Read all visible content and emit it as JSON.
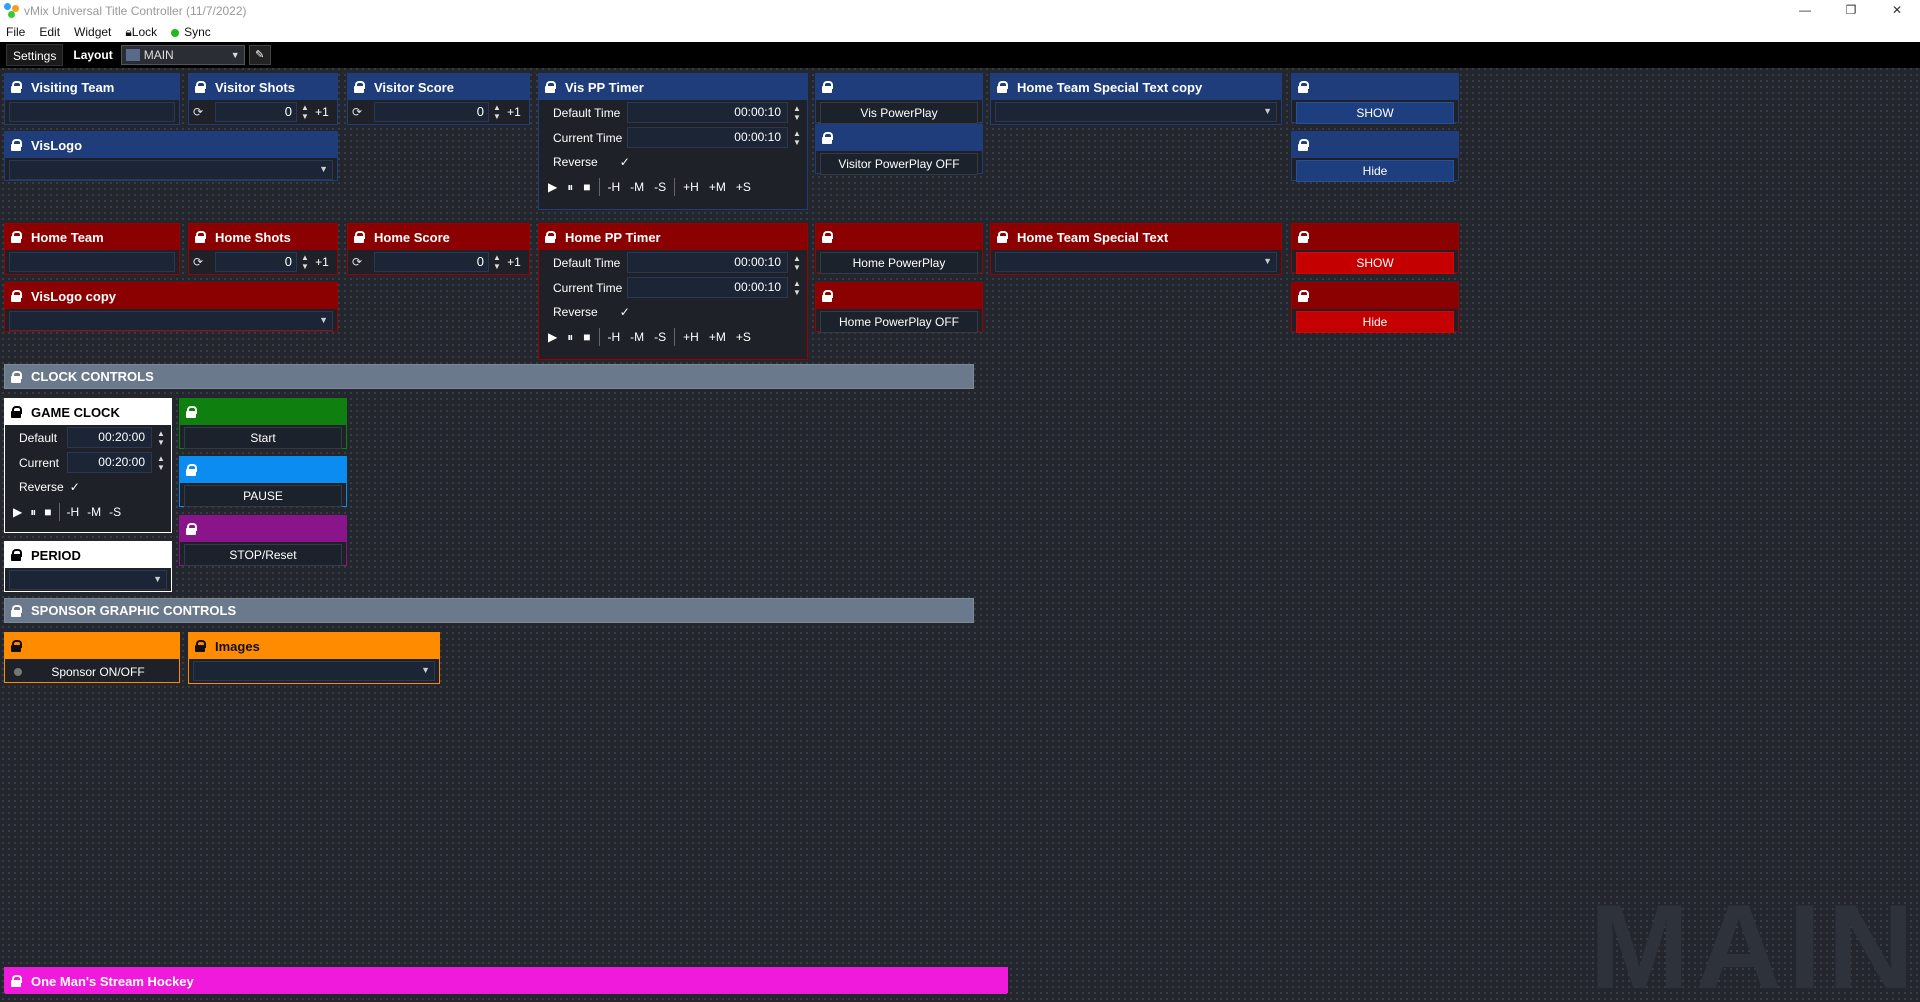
{
  "window": {
    "title": "vMix Universal Title Controller (11/7/2022)",
    "buttons": [
      "—",
      "❐",
      "✕"
    ]
  },
  "menu": {
    "file": "File",
    "edit": "Edit",
    "widget": "Widget",
    "lock": "🔒︎Lock",
    "sync": "Sync"
  },
  "toolbar": {
    "settings": "Settings",
    "layout": "Layout",
    "layout_value": "MAIN"
  },
  "widgets": {
    "visiting_team": {
      "title": "Visiting Team"
    },
    "visitor_shots": {
      "title": "Visitor Shots",
      "value": "0",
      "plus": "+1"
    },
    "visitor_score": {
      "title": "Visitor Score",
      "value": "0",
      "plus": "+1"
    },
    "vis_pp_timer": {
      "title": "Vis PP Timer",
      "default_label": "Default Time",
      "default_value": "00:00:10",
      "current_label": "Current Time",
      "current_value": "00:00:10",
      "reverse_label": "Reverse",
      "check": "✓"
    },
    "vis_powerplay": {
      "label": "Vis PowerPlay"
    },
    "visitor_powerplay_off": {
      "label": "Visitor PowerPlay OFF"
    },
    "home_special_copy": {
      "title": "Home Team Special Text copy"
    },
    "show_blue": {
      "label": "SHOW"
    },
    "hide_blue": {
      "label": "Hide"
    },
    "vislogo": {
      "title": "VisLogo"
    },
    "home_team": {
      "title": "Home Team"
    },
    "home_shots": {
      "title": "Home Shots",
      "value": "0",
      "plus": "+1"
    },
    "home_score": {
      "title": "Home Score",
      "value": "0",
      "plus": "+1"
    },
    "home_pp_timer": {
      "title": "Home PP Timer",
      "default_label": "Default Time",
      "default_value": "00:00:10",
      "current_label": "Current Time",
      "current_value": "00:00:10",
      "reverse_label": "Reverse",
      "check": "✓"
    },
    "home_powerplay": {
      "label": "Home PowerPlay"
    },
    "home_powerplay_off": {
      "label": "Home PowerPlay OFF"
    },
    "home_special": {
      "title": "Home Team Special Text"
    },
    "show_red": {
      "label": "SHOW"
    },
    "hide_red": {
      "label": "Hide"
    },
    "vislogo_copy": {
      "title": "VisLogo copy"
    },
    "clock_controls": {
      "title": "CLOCK CONTROLS"
    },
    "game_clock": {
      "title": "GAME CLOCK",
      "default_label": "Default",
      "default_value": "00:20:00",
      "current_label": "Current",
      "current_value": "00:20:00",
      "reverse_label": "Reverse",
      "check": "✓"
    },
    "start": {
      "label": "Start"
    },
    "pause": {
      "label": "PAUSE"
    },
    "stop": {
      "label": "STOP/Reset"
    },
    "period": {
      "title": "PERIOD"
    },
    "sponsor_controls": {
      "title": "SPONSOR GRAPHIC CONTROLS"
    },
    "sponsor_onoff": {
      "label": "Sponsor ON/OFF"
    },
    "images": {
      "title": "Images"
    },
    "footer": {
      "title": "One Man's Stream Hockey"
    }
  },
  "timer_controls": {
    "play": "▶",
    "pause": "⏸",
    "stop": "■",
    "mh": "-H",
    "mm": "-M",
    "ms": "-S",
    "ph": "+H",
    "pm": "+M",
    "ps": "+S"
  },
  "watermark": "MAIN",
  "colors": {
    "blue": "#1f3d7a",
    "red": "#8b0000",
    "green": "#0f7f0f",
    "cyan": "#0a8cf0",
    "purple": "#8a148a",
    "orange": "#ff8c00",
    "pink": "#f01adc",
    "gray": "#6a7a8c"
  }
}
